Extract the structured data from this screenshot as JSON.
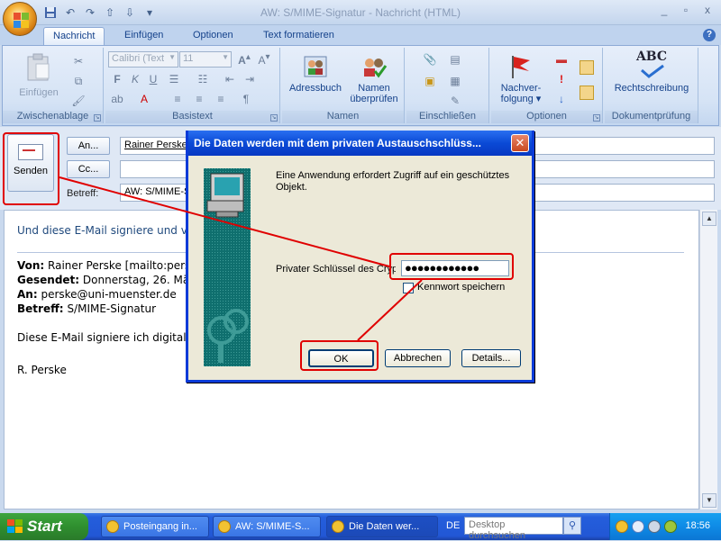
{
  "window": {
    "title": "AW: S/MIME-Signatur - Nachricht (HTML)",
    "controls": [
      "_",
      "▫",
      "x"
    ]
  },
  "qat": [
    "save-icon",
    "undo-icon",
    "redo-icon",
    "arrow-up-icon",
    "arrow-down-icon",
    "customize-icon"
  ],
  "tabs": [
    {
      "label": "Nachricht",
      "active": true
    },
    {
      "label": "Einfügen"
    },
    {
      "label": "Optionen"
    },
    {
      "label": "Text formatieren"
    }
  ],
  "ribbon": {
    "zwischenablage": {
      "label": "Zwischenablage",
      "paste": "Einfügen"
    },
    "basistext": {
      "label": "Basistext",
      "font": "Calibri (Text",
      "size": "11",
      "bold": "F",
      "italic": "K",
      "underline": "U"
    },
    "namen": {
      "label": "Namen",
      "adressbuch": "Adressbuch",
      "namen_pruefen_1": "Namen",
      "namen_pruefen_2": "überprüfen"
    },
    "einschliessen": {
      "label": "Einschließen"
    },
    "optionen": {
      "label": "Optionen",
      "nachverfolgung_1": "Nachver-",
      "nachverfolgung_2": "folgung"
    },
    "dokumentpruefung": {
      "label": "Dokumentprüfung",
      "rechtschreibung": "Rechtschreibung",
      "abc": "ABC"
    }
  },
  "header": {
    "send": "Senden",
    "to_button": "An...",
    "cc_button": "Cc...",
    "subject_label": "Betreff:",
    "to_value": "Rainer Perske",
    "cc_value": "",
    "subject_value": "AW: S/MIME-S"
  },
  "body": {
    "intro": "Und diese E-Mail signiere und v",
    "from_label": "Von:",
    "from_value": "Rainer Perske [mailto:persk",
    "sent_label": "Gesendet:",
    "sent_value": "Donnerstag, 26. Mär",
    "to_label": "An:",
    "to_value": "perske@uni-muenster.de",
    "subject_label": "Betreff:",
    "subject_value": "S/MIME-Signatur",
    "line1": "Diese E-Mail signiere ich digital",
    "signature": "R. Perske"
  },
  "dialog": {
    "title": "Die Daten werden mit dem privaten Austauschschlüss...",
    "close": "✕",
    "message": "Eine Anwendung erfordert Zugriff auf ein geschütztes Objekt.",
    "password_label": "Privater Schlüssel des CryptoAPI",
    "password_value": "●●●●●●●●●●●●",
    "remember_label": "Kennwort speichern",
    "remember_checked": false,
    "ok": "OK",
    "cancel": "Abbrechen",
    "details": "Details..."
  },
  "taskbar": {
    "start": "Start",
    "tasks": [
      {
        "label": "Posteingang in..."
      },
      {
        "label": "AW: S/MIME-S..."
      },
      {
        "label": "Die Daten wer...",
        "active": true
      }
    ],
    "language": "DE",
    "search_placeholder": "Desktop durchsuchen",
    "clock": "18:56"
  },
  "colors": {
    "accent_title": "#0a4ad6",
    "annotation_red": "#e00000",
    "ribbon_text": "#15428b"
  }
}
